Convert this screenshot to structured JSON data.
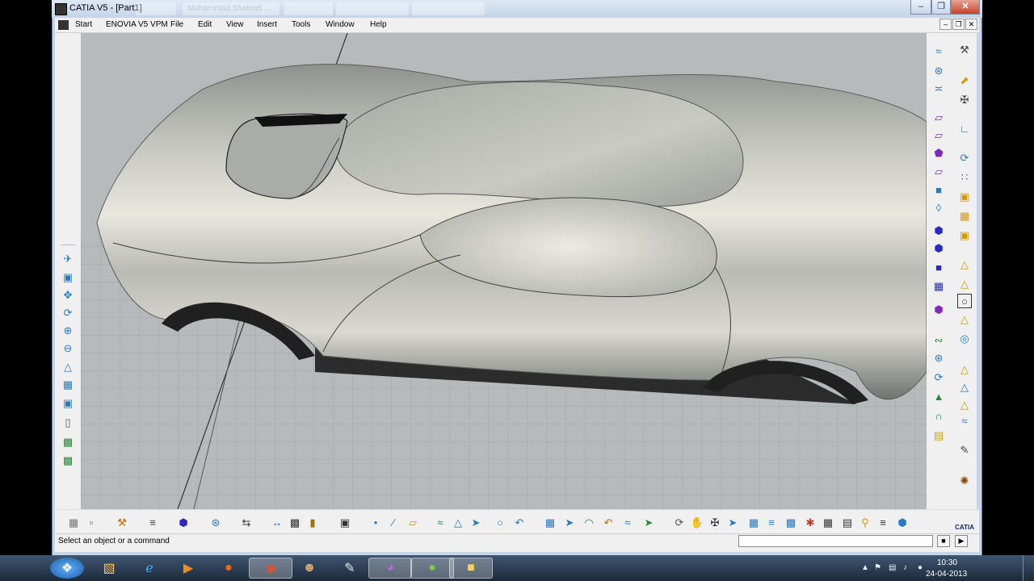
{
  "window": {
    "title": "CATIA V5 - [Part1]",
    "background_tabs": [
      "",
      "Mohammad Shakeel ...",
      "",
      "",
      ""
    ]
  },
  "menubar": {
    "items": [
      "Start",
      "ENOVIA V5 VPM",
      "File",
      "Edit",
      "View",
      "Insert",
      "Tools",
      "Window",
      "Help"
    ]
  },
  "status": {
    "message": "Select an object or a command",
    "command_input": ""
  },
  "taskbar": {
    "time": "10:30",
    "date": "24-04-2013",
    "apps": [
      "start-orb",
      "explorer",
      "internet-explorer",
      "media-player",
      "firefox",
      "chrome",
      "users",
      "paint",
      "media-app",
      "gtalk",
      "catia"
    ]
  },
  "colors": {
    "window_frame": "#c6d6ea",
    "viewport": "#b9bcbd",
    "toolbar": "#f0f0f0",
    "taskbar": "#2a3b50"
  }
}
